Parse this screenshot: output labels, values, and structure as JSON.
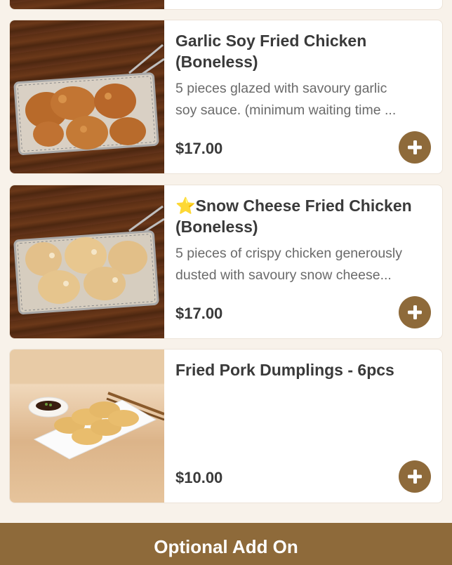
{
  "menu": {
    "items": [
      {
        "title_line1": "Garlic Soy Fried Chicken",
        "title_line2": "(Boneless)",
        "desc_line1": "5 pieces glazed with savoury garlic",
        "desc_line2": "soy sauce. (minimum waiting time ...",
        "price": "$17.00",
        "image_icon": "fried-chicken-basket-image"
      },
      {
        "star": "⭐",
        "title_line1": "Snow Cheese Fried Chicken",
        "title_line2": "(Boneless)",
        "desc_line1": "5 pieces of crispy chicken generously",
        "desc_line2": "dusted with savoury snow cheese...",
        "price": "$17.00",
        "image_icon": "snow-cheese-chicken-basket-image"
      },
      {
        "title_line1": "Fried Pork Dumplings - 6pcs",
        "price": "$10.00",
        "image_icon": "pork-dumplings-plate-image"
      }
    ]
  },
  "footer": {
    "label": "Optional Add On"
  },
  "colors": {
    "accent": "#8e6a3a",
    "background": "#f8f2ea",
    "text": "#3a3a3a",
    "muted": "#6a6a6a"
  }
}
